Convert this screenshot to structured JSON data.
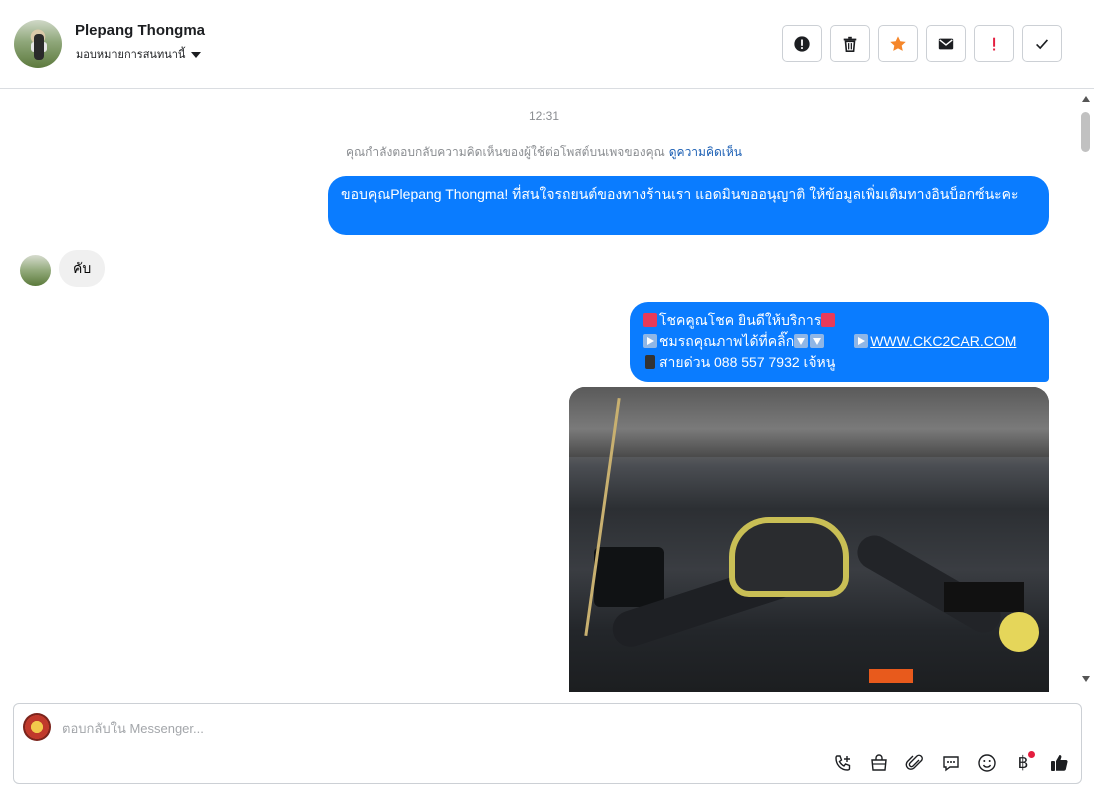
{
  "header": {
    "name": "Plepang Thongma",
    "assign_label": "มอบหมายการสนทนานี้",
    "actions": [
      {
        "name": "report-icon"
      },
      {
        "name": "trash-icon"
      },
      {
        "name": "star-icon",
        "color": "#f5862a"
      },
      {
        "name": "mail-icon"
      },
      {
        "name": "important-icon",
        "color": "#e41e3f"
      },
      {
        "name": "check-icon"
      }
    ]
  },
  "chat": {
    "timestamp": "12:31",
    "context_text": "คุณกำลังตอบกลับความคิดเห็นของผู้ใช้ต่อโพสต์บนเพจของคุณ",
    "context_link": "ดูความคิดเห็น",
    "out_message_1": "ขอบคุณPlepang Thongma! ที่สนใจรถยนต์ของทางร้านเรา แอดมินขออนุญาติ ให้ข้อมูลเพิ่มเติมทางอินบ็อกซ์นะคะ",
    "in_message": "คับ",
    "out_message_2": {
      "line1": "โชคคูณโชค ยินดีให้บริการ",
      "line2_a": "ชมรถคุณภาพได้ที่คลิ๊ก",
      "line2_link": "WWW.CKC2CAR.COM",
      "line3": "สายด่วน 088 557 7932 เจ้หนู"
    },
    "bubble_color": "#0a7cff"
  },
  "composer": {
    "placeholder": "ตอบกลับใน Messenger...",
    "tools": [
      "phone-add-icon",
      "shop-bag-icon",
      "attachment-icon",
      "chat-icon",
      "emoji-icon",
      "baht-icon",
      "thumbs-up-icon"
    ],
    "baht_symbol": "฿"
  }
}
